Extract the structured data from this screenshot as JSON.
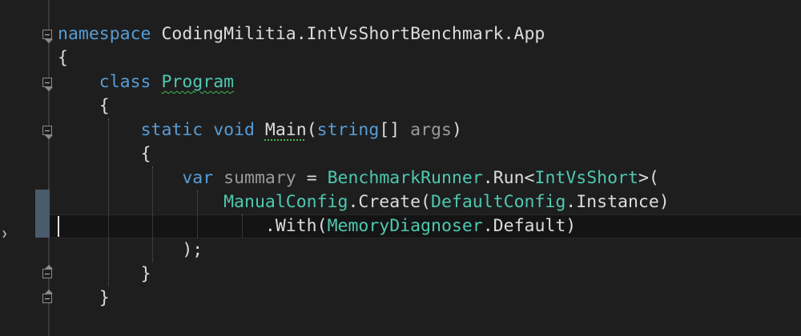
{
  "editor": {
    "lines": [
      {
        "indent": "",
        "tokens": [
          {
            "t": "namespace",
            "c": "kw"
          },
          {
            "t": " CodingMilitia.IntVsShortBenchmark.App",
            "c": "pl"
          }
        ]
      },
      {
        "indent": "",
        "tokens": [
          {
            "t": "{",
            "c": "pl"
          }
        ]
      },
      {
        "indent": "    ",
        "tokens": [
          {
            "t": "class",
            "c": "kw"
          },
          {
            "t": " ",
            "c": "pl"
          },
          {
            "t": "Program",
            "c": "ty squiggle-green"
          }
        ]
      },
      {
        "indent": "    ",
        "tokens": [
          {
            "t": "{",
            "c": "pl"
          }
        ]
      },
      {
        "indent": "        ",
        "tokens": [
          {
            "t": "static",
            "c": "kw"
          },
          {
            "t": " ",
            "c": "pl"
          },
          {
            "t": "void",
            "c": "kw"
          },
          {
            "t": " ",
            "c": "pl"
          },
          {
            "t": "Main",
            "c": "pl dots-green"
          },
          {
            "t": "(",
            "c": "pl"
          },
          {
            "t": "string",
            "c": "kw"
          },
          {
            "t": "[] ",
            "c": "pl"
          },
          {
            "t": "args",
            "c": "param"
          },
          {
            "t": ")",
            "c": "pl"
          }
        ]
      },
      {
        "indent": "        ",
        "tokens": [
          {
            "t": "{",
            "c": "pl"
          }
        ]
      },
      {
        "indent": "            ",
        "tokens": [
          {
            "t": "var",
            "c": "kw"
          },
          {
            "t": " ",
            "c": "pl"
          },
          {
            "t": "summary",
            "c": "param"
          },
          {
            "t": " = ",
            "c": "pl"
          },
          {
            "t": "BenchmarkRunner",
            "c": "ty"
          },
          {
            "t": ".Run<",
            "c": "pl"
          },
          {
            "t": "IntVsShort",
            "c": "ty"
          },
          {
            "t": ">(",
            "c": "pl"
          }
        ]
      },
      {
        "indent": "                ",
        "tokens": [
          {
            "t": "ManualConfig",
            "c": "ty"
          },
          {
            "t": ".Create(",
            "c": "pl"
          },
          {
            "t": "DefaultConfig",
            "c": "ty"
          },
          {
            "t": ".Instance)",
            "c": "pl"
          }
        ]
      },
      {
        "indent": "                    ",
        "tokens": [
          {
            "t": ".With(",
            "c": "pl"
          },
          {
            "t": "MemoryDiagnoser",
            "c": "ty"
          },
          {
            "t": ".Default)",
            "c": "pl"
          }
        ]
      },
      {
        "indent": "            ",
        "tokens": [
          {
            "t": ");",
            "c": "pl"
          }
        ]
      },
      {
        "indent": "        ",
        "tokens": [
          {
            "t": "}",
            "c": "pl"
          }
        ]
      },
      {
        "indent": "    ",
        "tokens": [
          {
            "t": "}",
            "c": "pl"
          }
        ]
      }
    ]
  }
}
